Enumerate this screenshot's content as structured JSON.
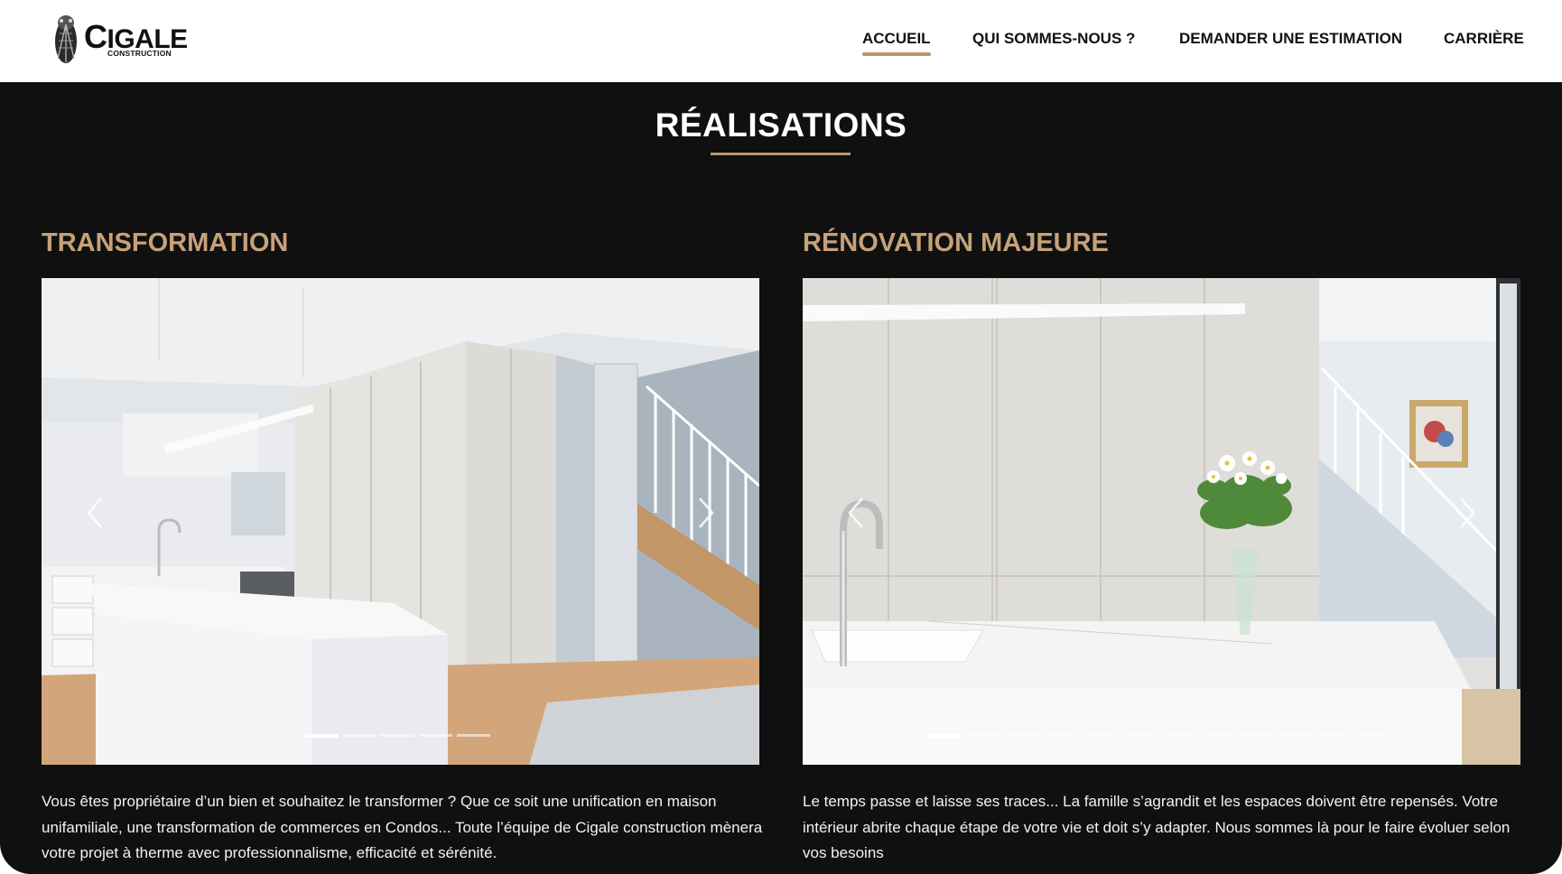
{
  "brand": {
    "name_big": "IGALE",
    "name_initial": "C",
    "name_small": "CONSTRUCTION"
  },
  "nav": {
    "items": [
      {
        "label": "ACCUEIL",
        "active": true
      },
      {
        "label": "QUI SOMMES-NOUS ?",
        "active": false
      },
      {
        "label": "DEMANDER UNE ESTIMATION",
        "active": false
      },
      {
        "label": "CARRIÈRE",
        "active": false
      }
    ]
  },
  "section": {
    "title": "RÉALISATIONS",
    "projects": [
      {
        "title": "TRANSFORMATION",
        "slide_count": 5,
        "active_slide": 1,
        "description": "Vous êtes propriétaire d’un bien et souhaitez le transformer ? Que ce soit une unification en maison unifamiliale, une transformation de commerces en Condos... Toute l’équipe de Cigale construction mènera votre projet à therme avec professionnalisme, efficacité et sérénité."
      },
      {
        "title": "RÉNOVATION MAJEURE",
        "slide_count": 12,
        "active_slide": 1,
        "description": "Le temps passe et laisse ses traces... La famille s’agrandit et les espaces doivent être repensés. Votre intérieur abrite chaque étape de votre vie et doit s’y adapter. Nous sommes là pour le faire évoluer selon vos besoins"
      }
    ]
  },
  "colors": {
    "accent": "#b8976b",
    "heading_gold": "#c7a17a",
    "section_bg": "#101010"
  },
  "icons": {
    "prev": "chevron-left-icon",
    "next": "chevron-right-icon",
    "logo": "cicada-logo-icon"
  }
}
